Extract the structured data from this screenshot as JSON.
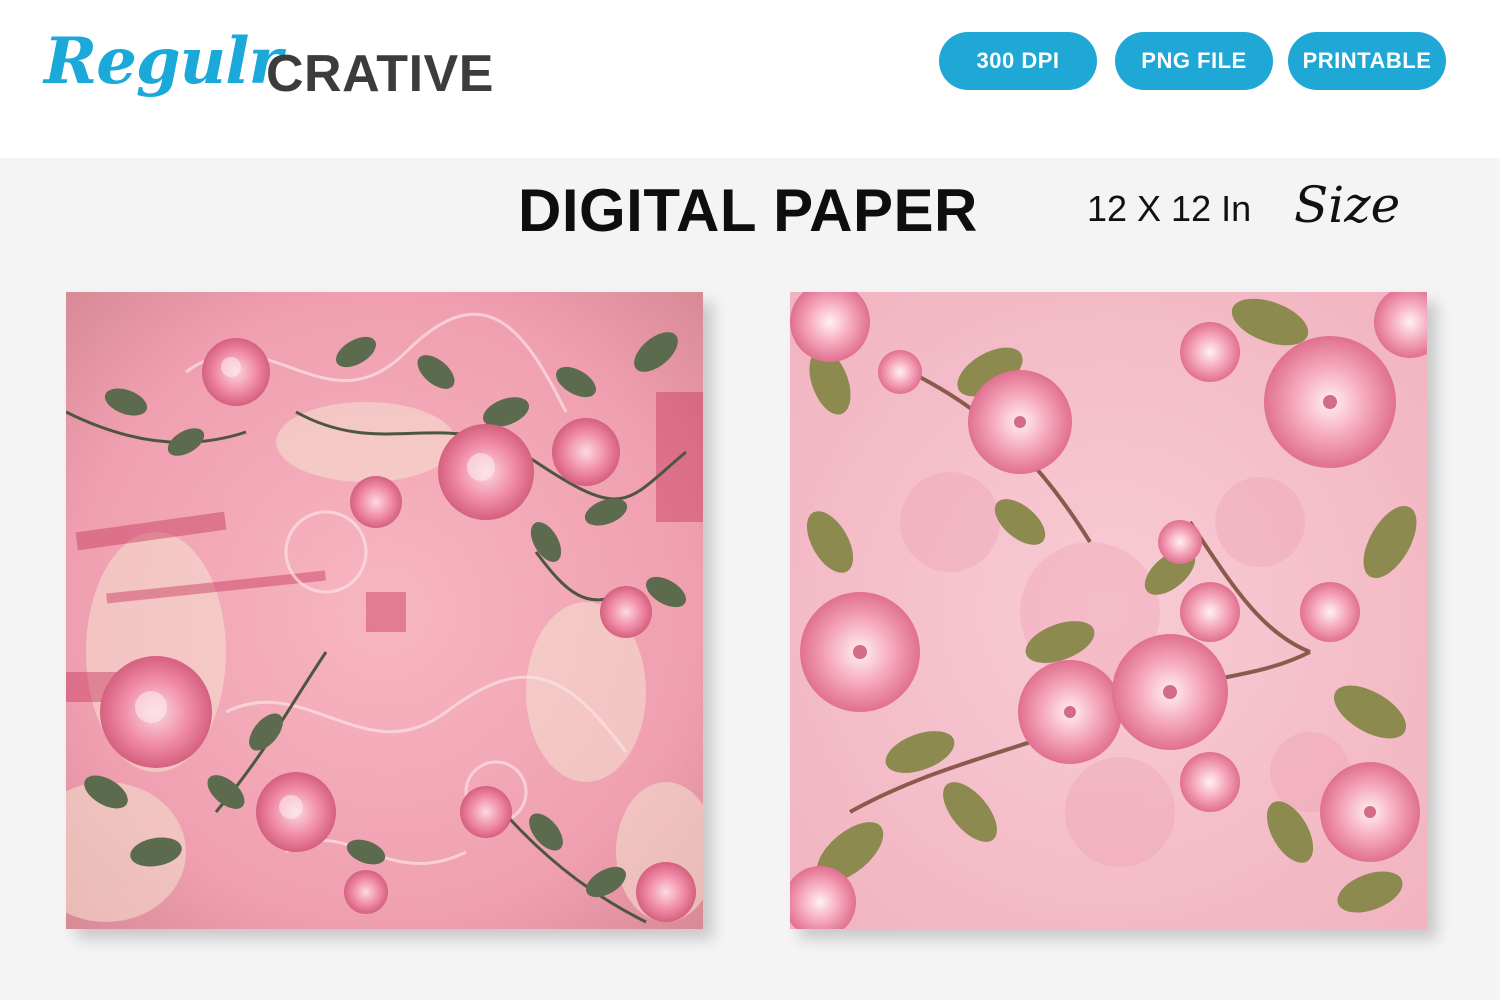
{
  "brand": {
    "script": "Regulr",
    "caps": "CRATIVE",
    "script_color": "#1aa9d9",
    "caps_color": "#3c3c3c"
  },
  "badges": [
    "300 DPI",
    "PNG FILE",
    "PRINTABLE"
  ],
  "badge_color": "#1fa7d6",
  "headline": "DIGITAL PAPER",
  "size": {
    "text": "12 X 12 In",
    "script": "Size"
  },
  "papers": [
    {
      "name": "pink-floral-grunge-paper",
      "base_color": "#f2a9b8",
      "leaf_color": "#5f6b4e"
    },
    {
      "name": "pink-blossom-paper",
      "base_color": "#f6c4cf",
      "leaf_color": "#8c8a52"
    }
  ]
}
